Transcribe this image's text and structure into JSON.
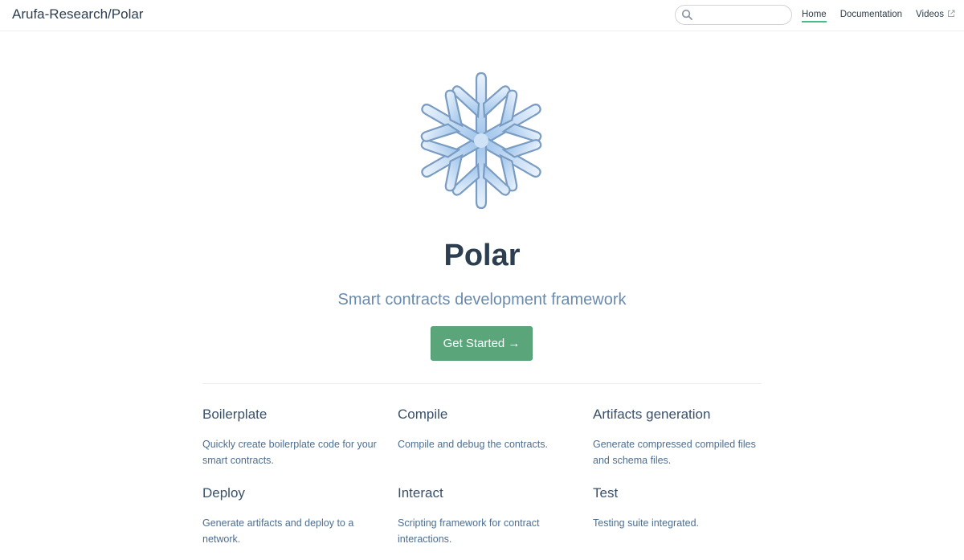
{
  "navbar": {
    "site_name": "Arufa-Research/Polar",
    "search": {
      "value": "",
      "icon": "search-icon"
    },
    "links": [
      {
        "label": "Home",
        "active": true
      },
      {
        "label": "Documentation",
        "active": false
      },
      {
        "label": "Videos",
        "active": false,
        "external": true
      }
    ]
  },
  "hero": {
    "logo_icon": "snowflake-icon",
    "title": "Polar",
    "description": "Smart contracts development framework",
    "action_label": "Get Started →"
  },
  "features": [
    {
      "title": "Boilerplate",
      "details": "Quickly create boilerplate code for your smart contracts."
    },
    {
      "title": "Compile",
      "details": "Compile and debug the contracts."
    },
    {
      "title": "Artifacts generation",
      "details": "Generate compressed compiled files and schema files."
    },
    {
      "title": "Deploy",
      "details": "Generate artifacts and deploy to a network."
    },
    {
      "title": "Interact",
      "details": "Scripting framework for contract interactions."
    },
    {
      "title": "Test",
      "details": "Testing suite integrated."
    }
  ],
  "colors": {
    "accent": "#46bd87",
    "button": "#5ba57b",
    "text": "#2c3e50",
    "muted": "#6a8bad"
  }
}
